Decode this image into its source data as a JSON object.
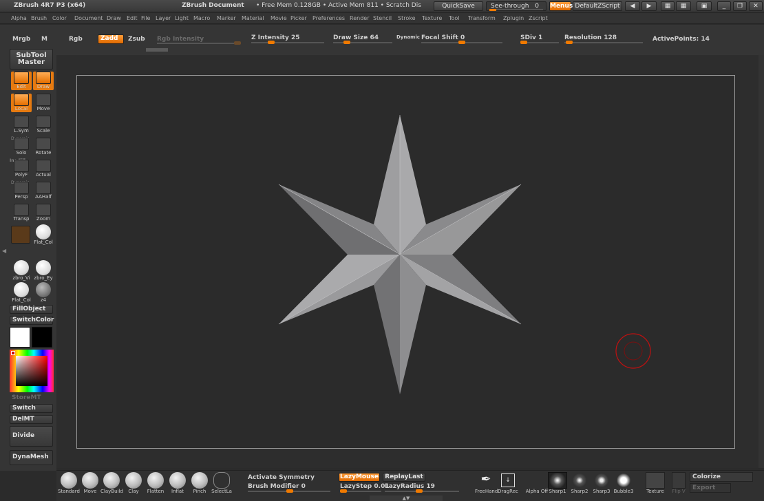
{
  "titlebar": {
    "app": "ZBrush 4R7 P3 (x64)",
    "document": "ZBrush Document",
    "mem": "• Free Mem 0.128GB • Active Mem 811 • Scratch Dis",
    "quicksave": "QuickSave",
    "seethrough": "See-through",
    "seethrough_value": "0",
    "menus": "Menus",
    "script": "DefaultZScript"
  },
  "menubar": [
    "Alpha",
    "Brush",
    "Color",
    "Document",
    "Draw",
    "Edit",
    "File",
    "Layer",
    "Light",
    "Macro",
    "Marker",
    "Material",
    "Movie",
    "Picker",
    "Preferences",
    "Render",
    "Stencil",
    "Stroke",
    "Texture",
    "Tool",
    "Transform",
    "Zplugin",
    "Zscript"
  ],
  "topshelf": {
    "mrgb": "Mrgb",
    "m": "M",
    "rgb": "Rgb",
    "zadd": "Zadd",
    "zsub": "Zsub",
    "rgb_intensity": "Rgb Intensity",
    "z_intensity_label": "Z Intensity",
    "z_intensity": "25",
    "z_intensity_level": 0.25,
    "draw_size_label": "Draw Size",
    "draw_size": "64",
    "draw_size_level": 0.2,
    "dynamic": "Dynamic",
    "focal_label": "Focal Shift",
    "focal": "0",
    "focal_level": 0.5,
    "sdiv_label": "SDiv",
    "sdiv": "1",
    "resolution_label": "Resolution",
    "resolution": "128",
    "activepoints_label": "ActivePoints:",
    "activepoints": "14"
  },
  "leftshelf": {
    "subtool_master": "SubTool Master",
    "tools": [
      {
        "label": "Edit",
        "icon": "edit-icon",
        "on": true
      },
      {
        "label": "Draw",
        "icon": "draw-icon",
        "on": true
      },
      {
        "label": "Local",
        "icon": "local-icon",
        "on": true
      },
      {
        "label": "Move",
        "icon": "move-icon",
        "on": false
      },
      {
        "label": "L.Sym",
        "icon": "lsym-icon",
        "on": false
      },
      {
        "label": "Scale",
        "icon": "scale-icon",
        "on": false
      },
      {
        "label": "Solo",
        "icon": "solo-icon",
        "on": false
      },
      {
        "label": "Rotate",
        "icon": "rotate-icon",
        "on": false
      },
      {
        "label": "PolyF",
        "icon": "polyf-icon",
        "on": false
      },
      {
        "label": "Actual",
        "icon": "actual-icon",
        "on": false
      },
      {
        "label": "Persp",
        "icon": "persp-icon",
        "on": false
      },
      {
        "label": "AAHalf",
        "icon": "aahalf-icon",
        "on": false
      },
      {
        "label": "Transp",
        "icon": "transp-icon",
        "on": false
      },
      {
        "label": "Zoom",
        "icon": "zoom-icon",
        "on": false
      }
    ],
    "dynamic_label": "Dynamic",
    "linefill_label": "Ine Fill",
    "materials": [
      {
        "label": "Flat_Col"
      },
      {
        "label": "zbro_Vi"
      },
      {
        "label": "zbro_Ey"
      },
      {
        "label": "Flat_Col"
      },
      {
        "label": "z4"
      }
    ],
    "fillobject": "FillObject",
    "switchcolor": "SwitchColor",
    "storemt": "StoreMT",
    "switch": "Switch",
    "delmt": "DelMT",
    "divide": "Divide",
    "dynamesh": "DynaMesh"
  },
  "bottomshelf": {
    "brushes": [
      "Standard",
      "Move",
      "ClayBuild",
      "Clay",
      "Flatten",
      "Inflat",
      "Pinch",
      "SelectLa"
    ],
    "activate_symmetry": "Activate Symmetry",
    "brush_modifier_label": "Brush Modifier",
    "brush_modifier": "0",
    "lazymouse": "LazyMouse",
    "replaylast": "ReplayLast",
    "lazystep_label": "LazyStep",
    "lazystep": "0.01",
    "lazyradius_label": "LazyRadius",
    "lazyradius": "19",
    "strokes": [
      "FreeHand",
      "DragRec"
    ],
    "alphas": [
      "Alpha Off",
      "Sharp1",
      "Sharp2",
      "Sharp3",
      "Bubble3"
    ],
    "texture": "Texture",
    "flipv": "Flip V",
    "colorize": "Colorize",
    "export": "Export"
  },
  "colors": {
    "accent": "#f07a00",
    "canvas": "#2b2b2b",
    "star_light": "#a8a8aa",
    "star_dark": "#6e6e70",
    "brush_cursor": "#c01010"
  }
}
